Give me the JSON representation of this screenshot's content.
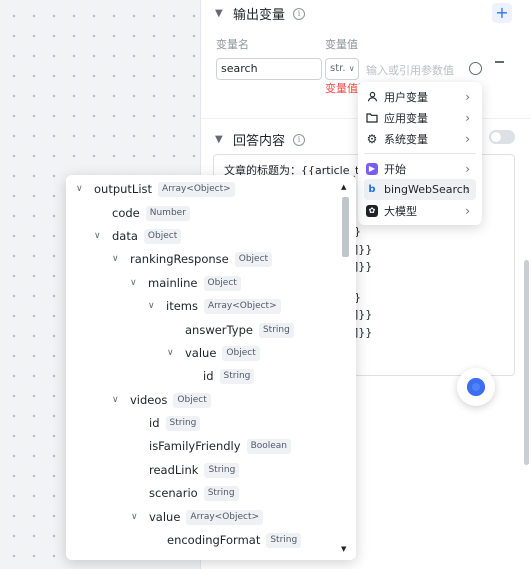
{
  "output_section": {
    "title": "输出变量",
    "add_label": "+",
    "col_name": "变量名",
    "col_value": "变量值",
    "name_value": "search",
    "type_value": "str.",
    "value_placeholder": "输入或引用参数值",
    "error_text": "变量值不"
  },
  "answer_section": {
    "title": "回答内容",
    "editor_lines": [
      "文章的标题为：{{article_titl",
      "}",
      "]}}",
      "]}}",
      "}",
      "]}}",
      "]}}"
    ]
  },
  "menu": {
    "items": [
      {
        "label": "用户变量",
        "icon": "user-icon"
      },
      {
        "label": "应用变量",
        "icon": "folder-icon"
      },
      {
        "label": "系统变量",
        "icon": "gear-icon"
      },
      {
        "label": "开始",
        "icon": "start-node-icon"
      },
      {
        "label": "bingWebSearch",
        "icon": "bing-icon"
      },
      {
        "label": "大模型",
        "icon": "llm-icon"
      }
    ]
  },
  "tree": {
    "nodes": [
      {
        "label": "outputList",
        "type": "Array<Object>",
        "caret": "v"
      },
      {
        "label": "code",
        "type": "Number",
        "caret": ""
      },
      {
        "label": "data",
        "type": "Object",
        "caret": "v"
      },
      {
        "label": "rankingResponse",
        "type": "Object",
        "caret": "v"
      },
      {
        "label": "mainline",
        "type": "Object",
        "caret": "v"
      },
      {
        "label": "items",
        "type": "Array<Object>",
        "caret": "v"
      },
      {
        "label": "answerType",
        "type": "String",
        "caret": ""
      },
      {
        "label": "value",
        "type": "Object",
        "caret": "v"
      },
      {
        "label": "id",
        "type": "String",
        "caret": ""
      },
      {
        "label": "videos",
        "type": "Object",
        "caret": "v"
      },
      {
        "label": "id",
        "type": "String",
        "caret": ""
      },
      {
        "label": "isFamilyFriendly",
        "type": "Boolean",
        "caret": ""
      },
      {
        "label": "readLink",
        "type": "String",
        "caret": ""
      },
      {
        "label": "scenario",
        "type": "String",
        "caret": ""
      },
      {
        "label": "value",
        "type": "Array<Object>",
        "caret": "v"
      },
      {
        "label": "encodingFormat",
        "type": "String",
        "caret": ""
      }
    ]
  },
  "colors": {
    "accent": "#3370ff",
    "error": "#f54a45"
  }
}
